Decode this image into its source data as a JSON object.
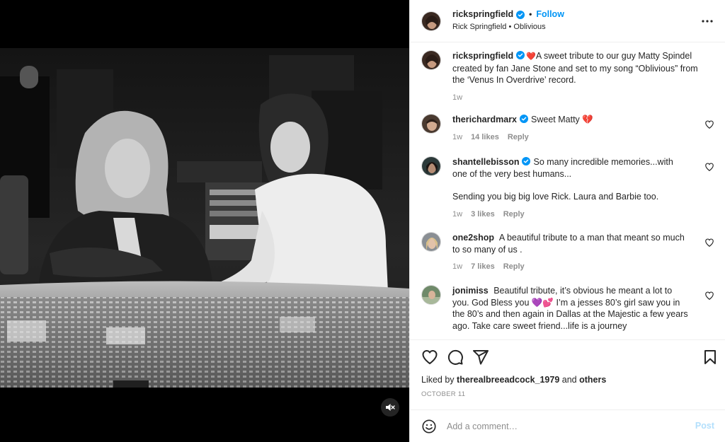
{
  "post": {
    "username": "rickspringfield",
    "follow_label": "Follow",
    "separator": "•",
    "subtitle_artist": "Rick Springfield",
    "subtitle_dot": "•",
    "subtitle_song": "Oblivious"
  },
  "caption": {
    "username": "rickspringfield",
    "emoji": "❤️",
    "text": "A sweet tribute to our guy Matty Spindel created by fan Jane Stone and set to my song “Oblivious” from the ‘Venus In Overdrive’ record.",
    "time": "1w"
  },
  "comments": [
    {
      "username": "therichardmarx",
      "verified": true,
      "text": "Sweet Matty 💔",
      "text2": "",
      "time": "1w",
      "likes": "14 likes",
      "reply": "Reply"
    },
    {
      "username": "shantellebisson",
      "verified": true,
      "text": "So many incredible memories...with one of the very best humans...",
      "text2": "Sending you big big love Rick. Laura and Barbie too.",
      "time": "1w",
      "likes": "3 likes",
      "reply": "Reply"
    },
    {
      "username": "one2shop",
      "verified": false,
      "text": "A beautiful tribute to a man that meant so much to so many of us .",
      "text2": "",
      "time": "1w",
      "likes": "7 likes",
      "reply": "Reply"
    },
    {
      "username": "jonimiss",
      "verified": false,
      "text": "Beautiful tribute, it’s obvious he meant a lot to you. God Bless you 💜💕 I’m a jesses 80’s girl saw you in the 80’s and then again in Dallas at the Majestic a few years ago. Take care sweet friend...life is a journey",
      "text2": "",
      "time": "",
      "likes": "",
      "reply": ""
    }
  ],
  "likes": {
    "prefix": "Liked by",
    "user": "therealbreeadcock_1979",
    "joiner": "and",
    "others": "others"
  },
  "date": "OCTOBER 11",
  "add_comment": {
    "placeholder": "Add a comment…",
    "post_label": "Post"
  },
  "icons": {
    "verified": "verified-badge-icon",
    "more": "more-horizontal-icon",
    "heart": "heart-icon",
    "comment": "comment-icon",
    "share": "share-icon",
    "save": "bookmark-icon",
    "emoji": "emoji-smile-icon",
    "mute": "speaker-muted-icon"
  },
  "colors": {
    "link_blue": "#0095f6",
    "post_disabled": "#b2dffc",
    "muted_text": "#8e8e8e",
    "text": "#262626",
    "divider": "#efefef"
  }
}
